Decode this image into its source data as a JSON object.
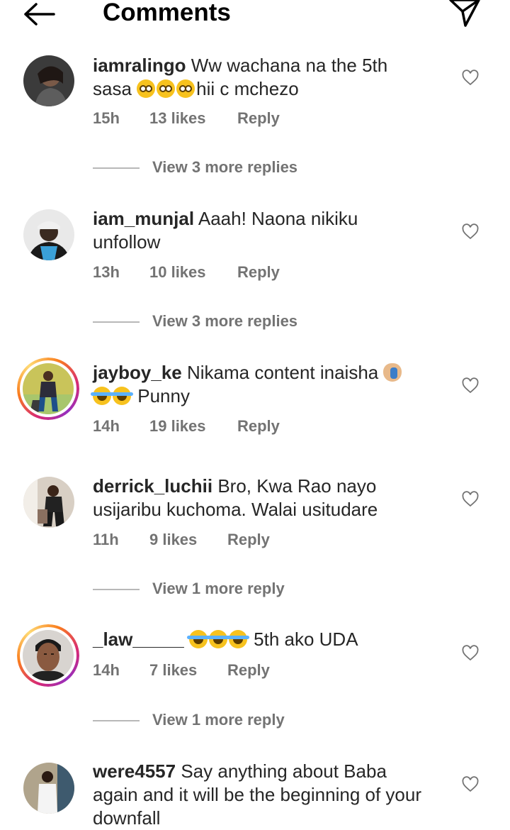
{
  "header": {
    "title": "Comments"
  },
  "comments": [
    {
      "username": "iamralingo",
      "text": "Ww wachana na the 5th sasa",
      "text_after": "hii c mchezo",
      "emoji": [
        "flushed-face",
        "flushed-face",
        "flushed-face"
      ],
      "time": "15h",
      "likes": "13 likes",
      "reply": "Reply",
      "more_replies": "View 3 more replies"
    },
    {
      "username": "iam_munjal",
      "text": "Aaah! Naona nikiku unfollow",
      "time": "13h",
      "likes": "10 likes",
      "reply": "Reply",
      "more_replies": "View 3 more replies"
    },
    {
      "username": "jayboy_ke",
      "text": "Nikama content inaisha",
      "text_after": "Punny",
      "emoji": [
        "facepalm",
        "face-with-tears-of-joy",
        "face-with-tears-of-joy"
      ],
      "time": "14h",
      "likes": "19 likes",
      "reply": "Reply"
    },
    {
      "username": "derrick_luchii",
      "text": "Bro, Kwa Rao nayo usijaribu kuchoma. Walai usitudare",
      "time": "11h",
      "likes": "9 likes",
      "reply": "Reply",
      "more_replies": "View 1 more reply"
    },
    {
      "username": "_law_____",
      "text": "5th ako UDA",
      "emoji": [
        "face-with-tears-of-joy",
        "face-with-tears-of-joy",
        "face-with-tears-of-joy"
      ],
      "time": "14h",
      "likes": "7 likes",
      "reply": "Reply",
      "more_replies": "View 1 more reply"
    },
    {
      "username": "were4557",
      "text": "Say anything about Baba again and it will be the beginning of your downfall"
    }
  ],
  "icons": {
    "back": "arrow-left-icon",
    "send": "paper-plane-icon",
    "like": "heart-outline-icon"
  },
  "colors": {
    "text": "#262626",
    "secondary": "#737373",
    "story_ring": [
      "#d62976",
      "#fa7e1e",
      "#feda75",
      "#962fbf"
    ]
  }
}
